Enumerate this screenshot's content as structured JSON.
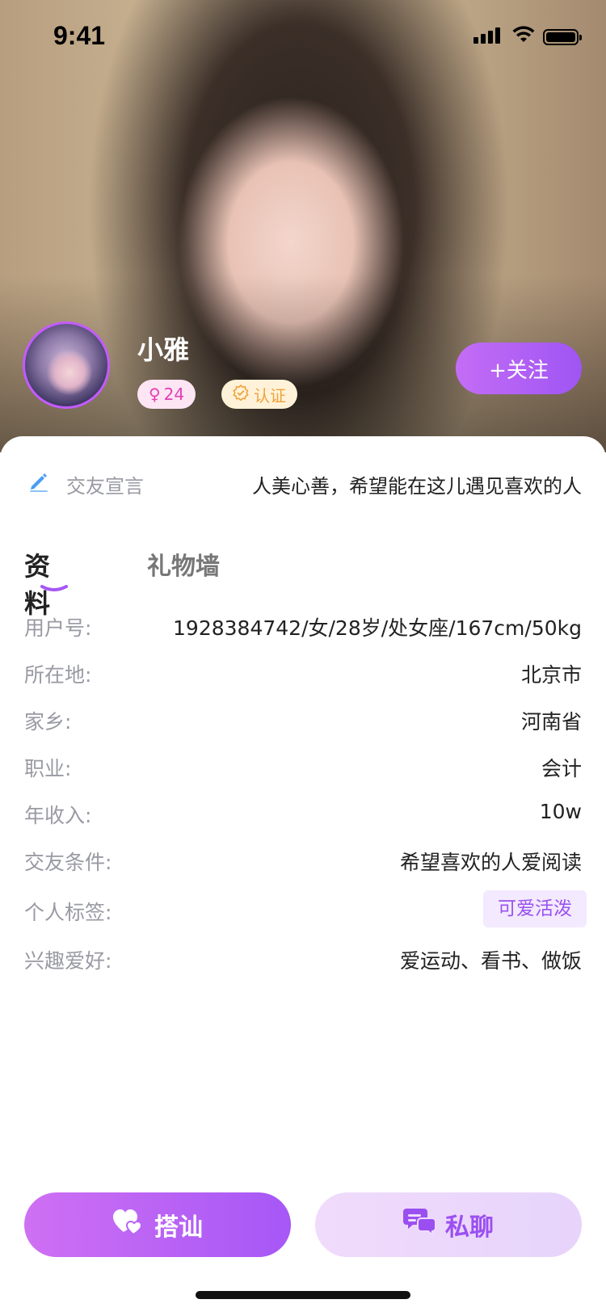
{
  "status_bar": {
    "time": "9:41"
  },
  "profile": {
    "nickname": "小雅",
    "age": "24",
    "gender_symbol": "♀",
    "verified_label": "认证",
    "follow_label": "+关注"
  },
  "motto": {
    "label": "交友宣言",
    "text": "人美心善，希望能在这儿遇见喜欢的人"
  },
  "tabs": [
    {
      "label": "资料",
      "active": true
    },
    {
      "label": "礼物墙",
      "active": false
    }
  ],
  "details": [
    {
      "key": "用户号:",
      "value": "1928384742/女/28岁/处女座/167cm/50kg"
    },
    {
      "key": "所在地:",
      "value": "北京市"
    },
    {
      "key": "家乡:",
      "value": "河南省"
    },
    {
      "key": "职业:",
      "value": "会计"
    },
    {
      "key": "年收入:",
      "value": "10w"
    },
    {
      "key": "交友条件:",
      "value": "希望喜欢的人爱阅读"
    },
    {
      "key": "个人标签:",
      "value": "可爱活泼"
    },
    {
      "key": "兴趣爱好:",
      "value": "爱运动、看书、做饭"
    }
  ],
  "actions": {
    "pickup_label": "搭讪",
    "chat_label": "私聊"
  },
  "colors": {
    "accent": "#a657f6",
    "accent_light": "#f0dbfb",
    "gender_pink": "#e03fb5",
    "verify_orange": "#f0a23a"
  }
}
